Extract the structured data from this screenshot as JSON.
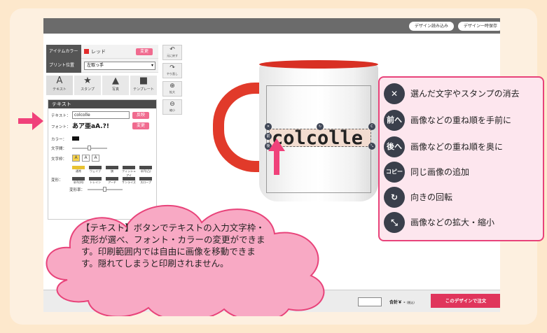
{
  "topbar": {
    "load_label": "デザイン読み込み",
    "save_label": "デザイン一時保存"
  },
  "item_color": {
    "label": "アイテムカラー",
    "value": "レッド",
    "swatch": "#e32b2b",
    "change_label": "変更"
  },
  "print_position": {
    "label": "プリント位置",
    "value": "左取っ手"
  },
  "tools": [
    {
      "label": "テキスト",
      "icon": "text-tool-icon"
    },
    {
      "label": "スタンプ",
      "icon": "stamp-tool-icon"
    },
    {
      "label": "写真",
      "icon": "photo-tool-icon"
    },
    {
      "label": "テンプレート",
      "icon": "template-tool-icon"
    }
  ],
  "text_panel": {
    "title": "テキスト",
    "text_label": "テキスト：",
    "text_value": "colcolle",
    "apply_label": "反映",
    "font_label": "フォント：",
    "font_sample": "あア亜aA.?!",
    "font_change_label": "変更",
    "color_label": "カラー：",
    "color_value": "#111111",
    "spacing_label": "文字間：",
    "frame_label": "文字枠：",
    "frame_options": [
      "A",
      "A",
      "A"
    ],
    "transform_label": "変形：",
    "transform_options": [
      "通常",
      "ウェイブ",
      "旗",
      "フィッシュアイ",
      "半円(凸)",
      "半円(凹)",
      "トレイン",
      "アーチ",
      "サンライズ",
      "スロープ"
    ],
    "ratio_label": "変形率："
  },
  "history": {
    "undo_label": "元に戻す",
    "redo_label": "やり直し",
    "zoom_in_label": "拡大",
    "zoom_out_label": "縮小"
  },
  "canvas": {
    "mug_text": "colcolle",
    "mug_color": "#e13a2a"
  },
  "bottom": {
    "total_label": "合計￥ - ",
    "total_suffix": "(税込)",
    "order_label": "このデザインで注文"
  },
  "legend": [
    {
      "icon": "close-icon",
      "glyph": "✕",
      "text": "選んだ文字やスタンプの消去"
    },
    {
      "icon": "bring-front-icon",
      "glyph": "前へ",
      "text": "画像などの重ね順を手前に"
    },
    {
      "icon": "send-back-icon",
      "glyph": "後へ",
      "text": "画像などの重ね順を奥に"
    },
    {
      "icon": "copy-icon",
      "glyph": "コピー",
      "text": "同じ画像の追加"
    },
    {
      "icon": "rotate-icon",
      "glyph": "↻",
      "text": "向きの回転"
    },
    {
      "icon": "resize-icon",
      "glyph": "⤡",
      "text": "画像などの拡大・縮小"
    }
  ],
  "callout": {
    "text": "【テキスト】ボタンでテキストの入力文字枠・変形が選べ、フォント・カラーの変更ができます。印刷範囲内では自由に画像を移動できます。隠れてしまうと印刷されません。"
  },
  "colors": {
    "accent_pink": "#e8437a",
    "order_button": "#e0355c",
    "legend_bg": "#fde6ee",
    "cloud": "#f8a9c4"
  }
}
